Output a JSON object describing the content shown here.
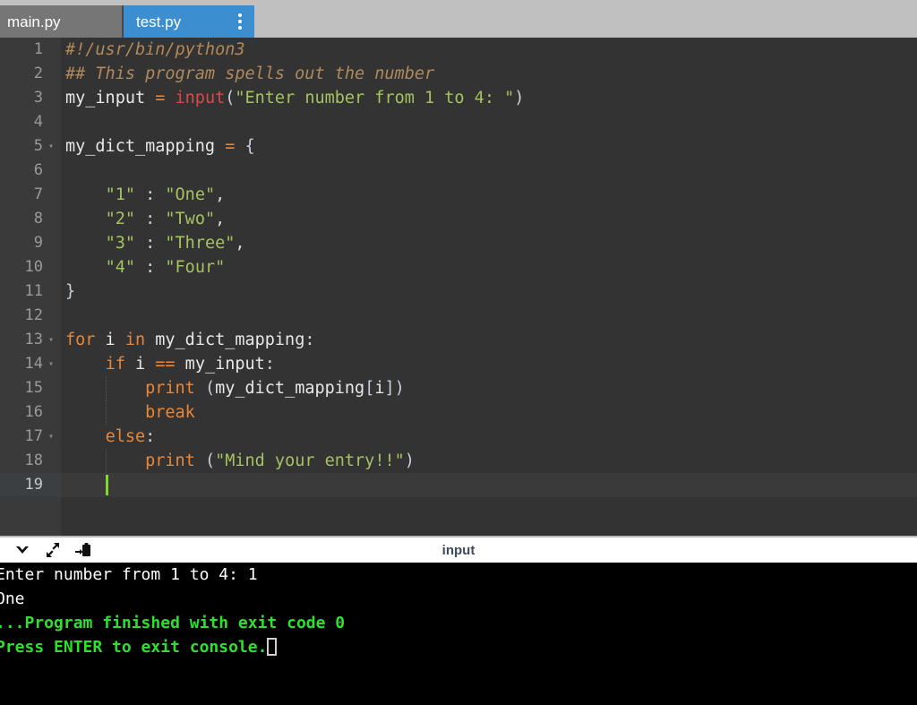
{
  "tabs": [
    {
      "label": "main.py",
      "active": false
    },
    {
      "label": "test.py",
      "active": true
    }
  ],
  "editor": {
    "language": "python",
    "current_line": 19,
    "lines": [
      {
        "n": 1,
        "fold": false,
        "tokens": [
          {
            "t": "#!/usr/bin/python3",
            "c": "tk-comment"
          }
        ]
      },
      {
        "n": 2,
        "fold": false,
        "tokens": [
          {
            "t": "## This program spells out the number",
            "c": "tk-comment"
          }
        ]
      },
      {
        "n": 3,
        "fold": false,
        "tokens": [
          {
            "t": "my_input ",
            "c": "tk-id"
          },
          {
            "t": "=",
            "c": "tk-op"
          },
          {
            "t": " ",
            "c": "tk-id"
          },
          {
            "t": "input",
            "c": "tk-builtin"
          },
          {
            "t": "(",
            "c": "tk-brk"
          },
          {
            "t": "\"Enter number from 1 to 4: \"",
            "c": "tk-str"
          },
          {
            "t": ")",
            "c": "tk-brk"
          }
        ]
      },
      {
        "n": 4,
        "fold": false,
        "tokens": []
      },
      {
        "n": 5,
        "fold": true,
        "tokens": [
          {
            "t": "my_dict_mapping ",
            "c": "tk-id"
          },
          {
            "t": "=",
            "c": "tk-op"
          },
          {
            "t": " ",
            "c": "tk-id"
          },
          {
            "t": "{",
            "c": "tk-brk"
          }
        ]
      },
      {
        "n": 6,
        "fold": false,
        "tokens": []
      },
      {
        "n": 7,
        "fold": false,
        "tokens": [
          {
            "t": "    ",
            "c": "tk-id"
          },
          {
            "t": "\"1\"",
            "c": "tk-str"
          },
          {
            "t": " : ",
            "c": "tk-punc"
          },
          {
            "t": "\"One\"",
            "c": "tk-str"
          },
          {
            "t": ",",
            "c": "tk-punc"
          }
        ]
      },
      {
        "n": 8,
        "fold": false,
        "tokens": [
          {
            "t": "    ",
            "c": "tk-id"
          },
          {
            "t": "\"2\"",
            "c": "tk-str"
          },
          {
            "t": " : ",
            "c": "tk-punc"
          },
          {
            "t": "\"Two\"",
            "c": "tk-str"
          },
          {
            "t": ",",
            "c": "tk-punc"
          }
        ]
      },
      {
        "n": 9,
        "fold": false,
        "tokens": [
          {
            "t": "    ",
            "c": "tk-id"
          },
          {
            "t": "\"3\"",
            "c": "tk-str"
          },
          {
            "t": " : ",
            "c": "tk-punc"
          },
          {
            "t": "\"Three\"",
            "c": "tk-str"
          },
          {
            "t": ",",
            "c": "tk-punc"
          }
        ]
      },
      {
        "n": 10,
        "fold": false,
        "tokens": [
          {
            "t": "    ",
            "c": "tk-id"
          },
          {
            "t": "\"4\"",
            "c": "tk-str"
          },
          {
            "t": " : ",
            "c": "tk-punc"
          },
          {
            "t": "\"Four\"",
            "c": "tk-str"
          }
        ]
      },
      {
        "n": 11,
        "fold": false,
        "tokens": [
          {
            "t": "}",
            "c": "tk-brk"
          }
        ]
      },
      {
        "n": 12,
        "fold": false,
        "tokens": []
      },
      {
        "n": 13,
        "fold": true,
        "tokens": [
          {
            "t": "for",
            "c": "tk-kw"
          },
          {
            "t": " i ",
            "c": "tk-id"
          },
          {
            "t": "in",
            "c": "tk-kw"
          },
          {
            "t": " my_dict_mapping",
            "c": "tk-id"
          },
          {
            "t": ":",
            "c": "tk-punc"
          }
        ]
      },
      {
        "n": 14,
        "fold": true,
        "tokens": [
          {
            "t": "    ",
            "c": "tk-id"
          },
          {
            "t": "if",
            "c": "tk-kw"
          },
          {
            "t": " i ",
            "c": "tk-id"
          },
          {
            "t": "==",
            "c": "tk-op"
          },
          {
            "t": " my_input",
            "c": "tk-id"
          },
          {
            "t": ":",
            "c": "tk-punc"
          }
        ]
      },
      {
        "n": 15,
        "fold": false,
        "guide": 4,
        "tokens": [
          {
            "t": "        ",
            "c": "tk-id"
          },
          {
            "t": "print",
            "c": "tk-kw"
          },
          {
            "t": " ",
            "c": "tk-id"
          },
          {
            "t": "(",
            "c": "tk-brk"
          },
          {
            "t": "my_dict_mapping",
            "c": "tk-id"
          },
          {
            "t": "[",
            "c": "tk-brk"
          },
          {
            "t": "i",
            "c": "tk-id"
          },
          {
            "t": "]",
            "c": "tk-brk"
          },
          {
            "t": ")",
            "c": "tk-brk"
          }
        ]
      },
      {
        "n": 16,
        "fold": false,
        "guide": 4,
        "tokens": [
          {
            "t": "        ",
            "c": "tk-id"
          },
          {
            "t": "break",
            "c": "tk-kw"
          }
        ]
      },
      {
        "n": 17,
        "fold": true,
        "tokens": [
          {
            "t": "    ",
            "c": "tk-id"
          },
          {
            "t": "else",
            "c": "tk-kw"
          },
          {
            "t": ":",
            "c": "tk-punc"
          }
        ]
      },
      {
        "n": 18,
        "fold": false,
        "guide": 4,
        "tokens": [
          {
            "t": "        ",
            "c": "tk-id"
          },
          {
            "t": "print",
            "c": "tk-kw"
          },
          {
            "t": " ",
            "c": "tk-id"
          },
          {
            "t": "(",
            "c": "tk-brk"
          },
          {
            "t": "\"Mind your entry!!\"",
            "c": "tk-str"
          },
          {
            "t": ")",
            "c": "tk-brk"
          }
        ]
      },
      {
        "n": 19,
        "fold": false,
        "cursor": true,
        "tokens": [
          {
            "t": "    ",
            "c": "tk-id"
          }
        ]
      }
    ]
  },
  "console_toolbar": {
    "title": "input",
    "buttons": [
      {
        "name": "collapse-console-button",
        "icon": "chevron-down-icon"
      },
      {
        "name": "maximize-console-button",
        "icon": "expand-arrows-icon"
      },
      {
        "name": "paste-to-console-button",
        "icon": "paste-icon"
      }
    ]
  },
  "console": {
    "lines": [
      {
        "text": "Enter number from 1 to 4: 1",
        "style": "normal"
      },
      {
        "text": "One",
        "style": "normal"
      },
      {
        "text": "",
        "style": "normal"
      },
      {
        "text": "",
        "style": "normal"
      },
      {
        "text": "...Program finished with exit code 0",
        "style": "green"
      },
      {
        "text": "Press ENTER to exit console.",
        "style": "green",
        "cursor": true
      }
    ]
  },
  "colors": {
    "tab_active": "#3b8ed0",
    "tab_inactive": "#767676",
    "tabbar_bg": "#c0c0c0",
    "editor_bg": "#333333",
    "gutter_bg": "#3a3a3a",
    "console_bg": "#000000",
    "console_green": "#2ee02e",
    "cursor_green": "#7fdb2a",
    "comment": "#b1895a",
    "keyword": "#e8873a",
    "builtin": "#d9484b",
    "string": "#a5c261"
  }
}
